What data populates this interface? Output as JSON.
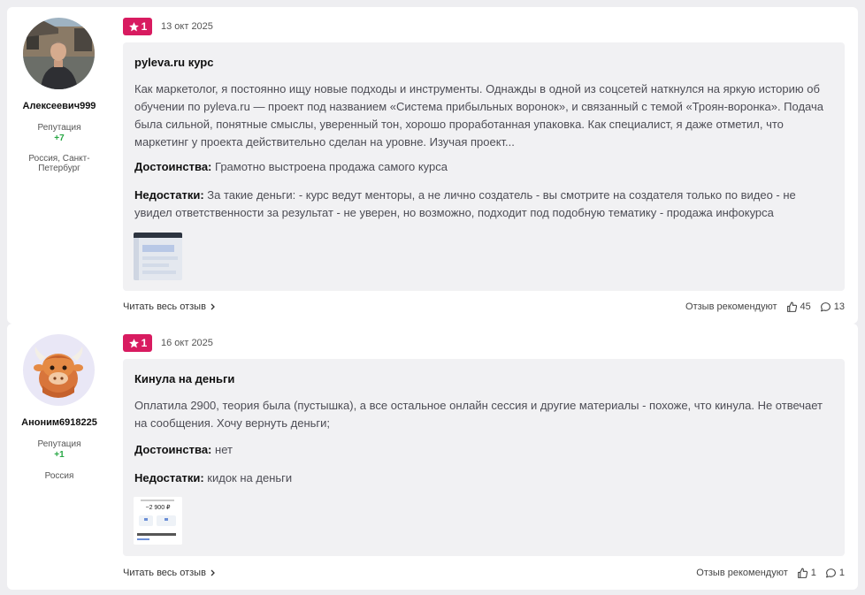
{
  "colors": {
    "rating": "#d81b60",
    "reputation": "#27a744",
    "review_bg": "#f1f1f3"
  },
  "reviews": [
    {
      "author": {
        "name": "Алексеевич999",
        "reputation_label": "Репутация",
        "reputation_value": "+7",
        "location": "Россия, Санкт-Петербург",
        "avatar_icon": "user-photo"
      },
      "rating": "1",
      "date": "13 окт 2025",
      "title": "pyleva.ru курс",
      "text": "Как маркетолог, я постоянно ищу новые подходы и инструменты. Однажды в одной из соцсетей наткнулся на яркую историю об обучении по pyleva.ru — проект под названием «Система прибыльных воронок», и связанный с темой «Троян-воронка». Подача была сильной, понятные смыслы, уверенный тон, хорошо проработанная упаковка. Как специалист, я даже отметил, что маркетинг у проекта действительно сделан на уровне. Изучая проект...",
      "pros_label": "Достоинства:",
      "pros": "Грамотно выстроена продажа самого курса",
      "cons_label": "Недостатки:",
      "cons": "За такие деньги: - курс ведут менторы, а не лично создатель - вы смотрите на создателя только по видео - не увидел ответственности за результат - не уверен, но возможно, подходит под подобную тематику - продажа инфокурса",
      "read_more": "Читать весь отзыв",
      "recommend_label": "Отзыв рекомендуют",
      "likes": "45",
      "comments": "13"
    },
    {
      "author": {
        "name": "Аноним6918225",
        "reputation_label": "Репутация",
        "reputation_value": "+1",
        "location": "Россия",
        "avatar_icon": "yak-avatar"
      },
      "rating": "1",
      "date": "16 окт 2025",
      "title": "Кинула на деньги",
      "text": "Оплатила 2900, теория была (пустышка), а все остальное онлайн сессия и другие материалы - похоже, что кинула. Не отвечает на сообщения. Хочу вернуть деньги;",
      "pros_label": "Достоинства:",
      "pros": "нет",
      "cons_label": "Недостатки:",
      "cons": "кидок на деньги",
      "thumb_amount": "−2 900 ₽",
      "read_more": "Читать весь отзыв",
      "recommend_label": "Отзыв рекомендуют",
      "likes": "1",
      "comments": "1"
    }
  ]
}
